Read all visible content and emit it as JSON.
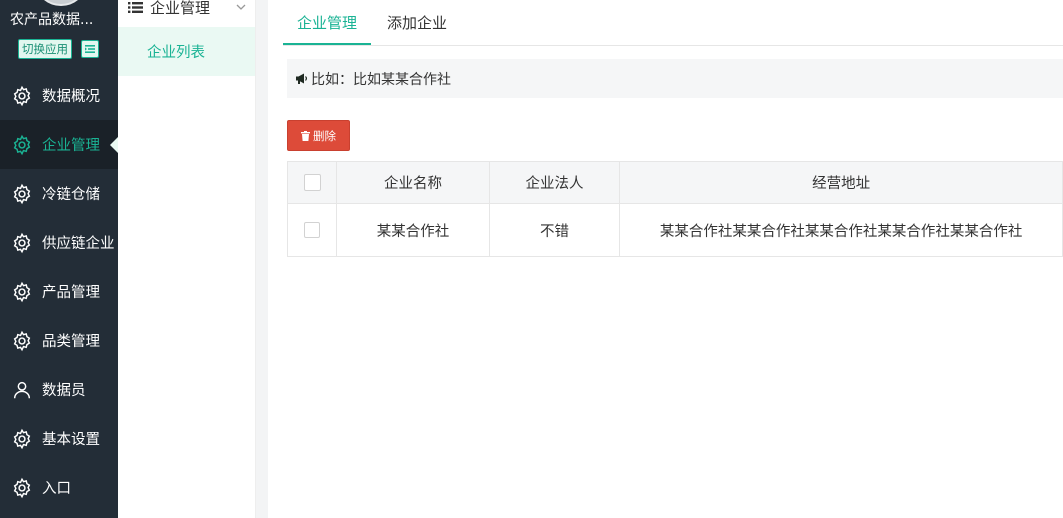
{
  "app": {
    "name": "农产品数据...",
    "switch_label": "切换应用"
  },
  "nav": {
    "items": [
      {
        "label": "数据概况",
        "icon": "gear-icon"
      },
      {
        "label": "企业管理",
        "icon": "gear-icon",
        "active": true
      },
      {
        "label": "冷链仓储",
        "icon": "gear-icon"
      },
      {
        "label": "供应链企业",
        "icon": "gear-icon"
      },
      {
        "label": "产品管理",
        "icon": "gear-icon"
      },
      {
        "label": "品类管理",
        "icon": "gear-icon"
      },
      {
        "label": "数据员",
        "icon": "user-icon"
      },
      {
        "label": "基本设置",
        "icon": "gear-icon"
      },
      {
        "label": "入口",
        "icon": "gear-icon"
      }
    ]
  },
  "subnav": {
    "title": "企业管理",
    "items": [
      {
        "label": "企业列表",
        "active": true
      }
    ]
  },
  "tabs": [
    {
      "label": "企业管理",
      "active": true
    },
    {
      "label": "添加企业"
    }
  ],
  "notice": {
    "text": "比如：比如某某合作社"
  },
  "toolbar": {
    "delete_label": "删除"
  },
  "table": {
    "headers": [
      "企业名称",
      "企业法人",
      "经营地址"
    ],
    "rows": [
      [
        "某某合作社",
        "不错",
        "某某合作社某某合作社某某合作社某某合作社某某合作社"
      ]
    ]
  },
  "colors": {
    "sidebar_bg": "#232d37",
    "accent": "#1ab394",
    "danger": "#dd4b39"
  }
}
